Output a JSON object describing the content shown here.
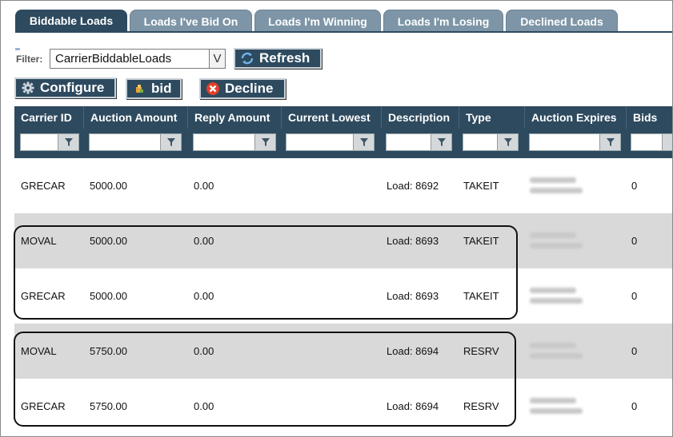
{
  "tabs": [
    {
      "label": "Biddable Loads",
      "active": true
    },
    {
      "label": "Loads I've Bid On",
      "active": false
    },
    {
      "label": "Loads I'm Winning",
      "active": false
    },
    {
      "label": "Loads I'm Losing",
      "active": false
    },
    {
      "label": "Declined Loads",
      "active": false
    }
  ],
  "filter": {
    "label": "Filter:",
    "value": "CarrierBiddableLoads",
    "arrow": "V"
  },
  "toolbar": {
    "refresh": "Refresh",
    "configure": "Configure",
    "bid": "bid",
    "decline": "Decline"
  },
  "columns": [
    "Carrier ID",
    "Auction Amount",
    "Reply Amount",
    "Current Lowest",
    "Description",
    "Type",
    "Auction Expires",
    "Bids"
  ],
  "rows": [
    {
      "carrier": "GRECAR",
      "auction": "5000.00",
      "reply": "0.00",
      "lowest": "",
      "description": "Load: 8692",
      "type": "TAKEIT",
      "bids": "0"
    },
    {
      "carrier": "MOVAL",
      "auction": "5000.00",
      "reply": "0.00",
      "lowest": "",
      "description": "Load: 8693",
      "type": "TAKEIT",
      "bids": "0"
    },
    {
      "carrier": "GRECAR",
      "auction": "5000.00",
      "reply": "0.00",
      "lowest": "",
      "description": "Load: 8693",
      "type": "TAKEIT",
      "bids": "0"
    },
    {
      "carrier": "MOVAL",
      "auction": "5750.00",
      "reply": "0.00",
      "lowest": "",
      "description": "Load: 8694",
      "type": "RESRV",
      "bids": "0"
    },
    {
      "carrier": "GRECAR",
      "auction": "5750.00",
      "reply": "0.00",
      "lowest": "",
      "description": "Load: 8694",
      "type": "RESRV",
      "bids": "0"
    }
  ],
  "colors": {
    "header": "#2e4a5f",
    "tab_inactive": "#7d95a6",
    "row_alt": "#d9d9d9"
  },
  "icons": {
    "refresh": "refresh-icon",
    "configure": "gear-icon",
    "bid": "bid-icon",
    "decline": "decline-icon",
    "filter": "funnel-icon"
  }
}
